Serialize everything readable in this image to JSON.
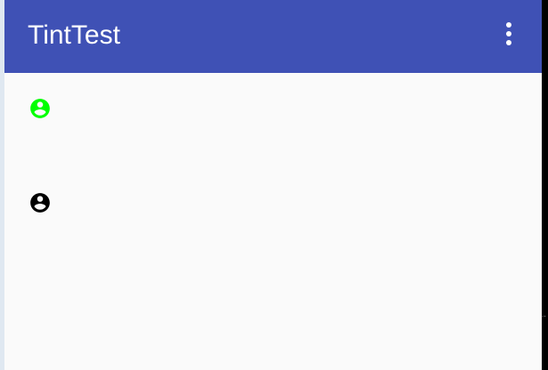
{
  "app_bar": {
    "title": "TintTest",
    "background": "#3f51b5",
    "overflow_icon": "more-vert-icon"
  },
  "content": {
    "background": "#fafafa",
    "icons": [
      {
        "icon": "account-circle-icon",
        "tint": "#00ff00"
      },
      {
        "icon": "account-circle-icon",
        "tint": "#000000"
      }
    ]
  }
}
